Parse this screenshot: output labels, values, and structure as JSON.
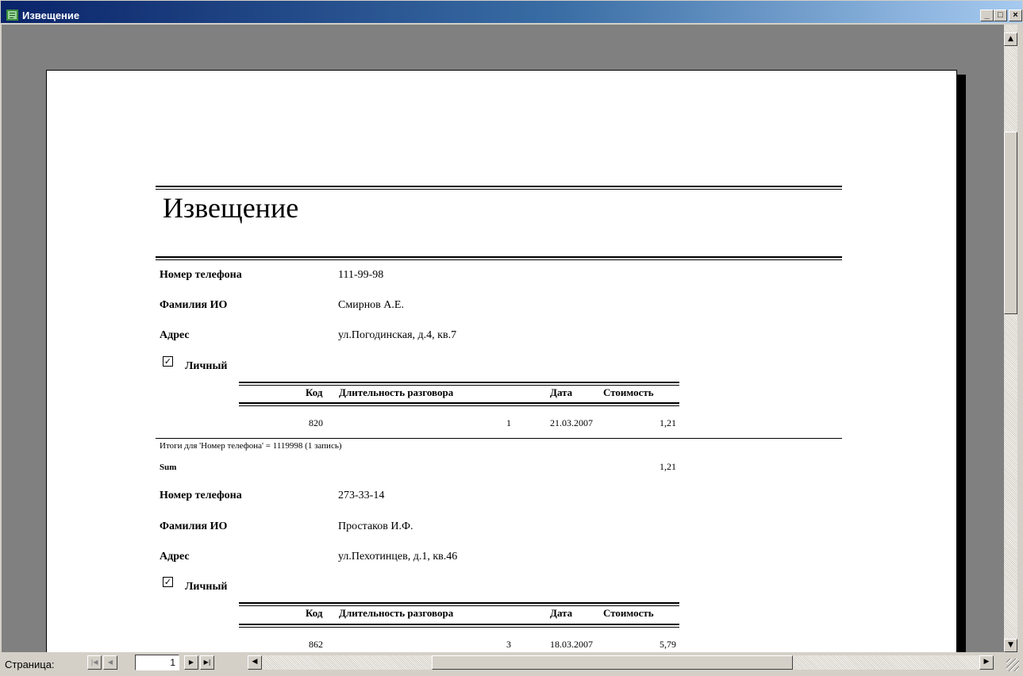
{
  "window": {
    "title": "Извещение",
    "minimize": "_",
    "maximize": "□",
    "close": "×"
  },
  "report": {
    "title": "Извещение",
    "labels": {
      "phone": "Номер телефона",
      "name": "Фамилия ИО",
      "address": "Адрес",
      "personal": "Личный"
    },
    "table_headers": {
      "code": "Код",
      "duration": "Длительность разговора",
      "date": "Дата",
      "cost": "Стоимость"
    },
    "records": [
      {
        "phone": "111-99-98",
        "name": "Смирнов А.Е.",
        "address": "ул.Погодинская, д.4, кв.7",
        "personal": true,
        "rows": [
          {
            "code": "820",
            "duration": "1",
            "date": "21.03.2007",
            "cost": "1,21"
          }
        ],
        "summary": "Итоги для 'Номер телефона' =  1119998 (1 запись)",
        "sum_label": "Sum",
        "sum_value": "1,21"
      },
      {
        "phone": "273-33-14",
        "name": "Простаков И.Ф.",
        "address": "ул.Пехотинцев, д.1, кв.46",
        "personal": true,
        "rows": [
          {
            "code": "862",
            "duration": "3",
            "date": "18.03.2007",
            "cost": "5,79"
          }
        ]
      }
    ]
  },
  "statusbar": {
    "page_label": "Страница:",
    "page_number": "1"
  }
}
